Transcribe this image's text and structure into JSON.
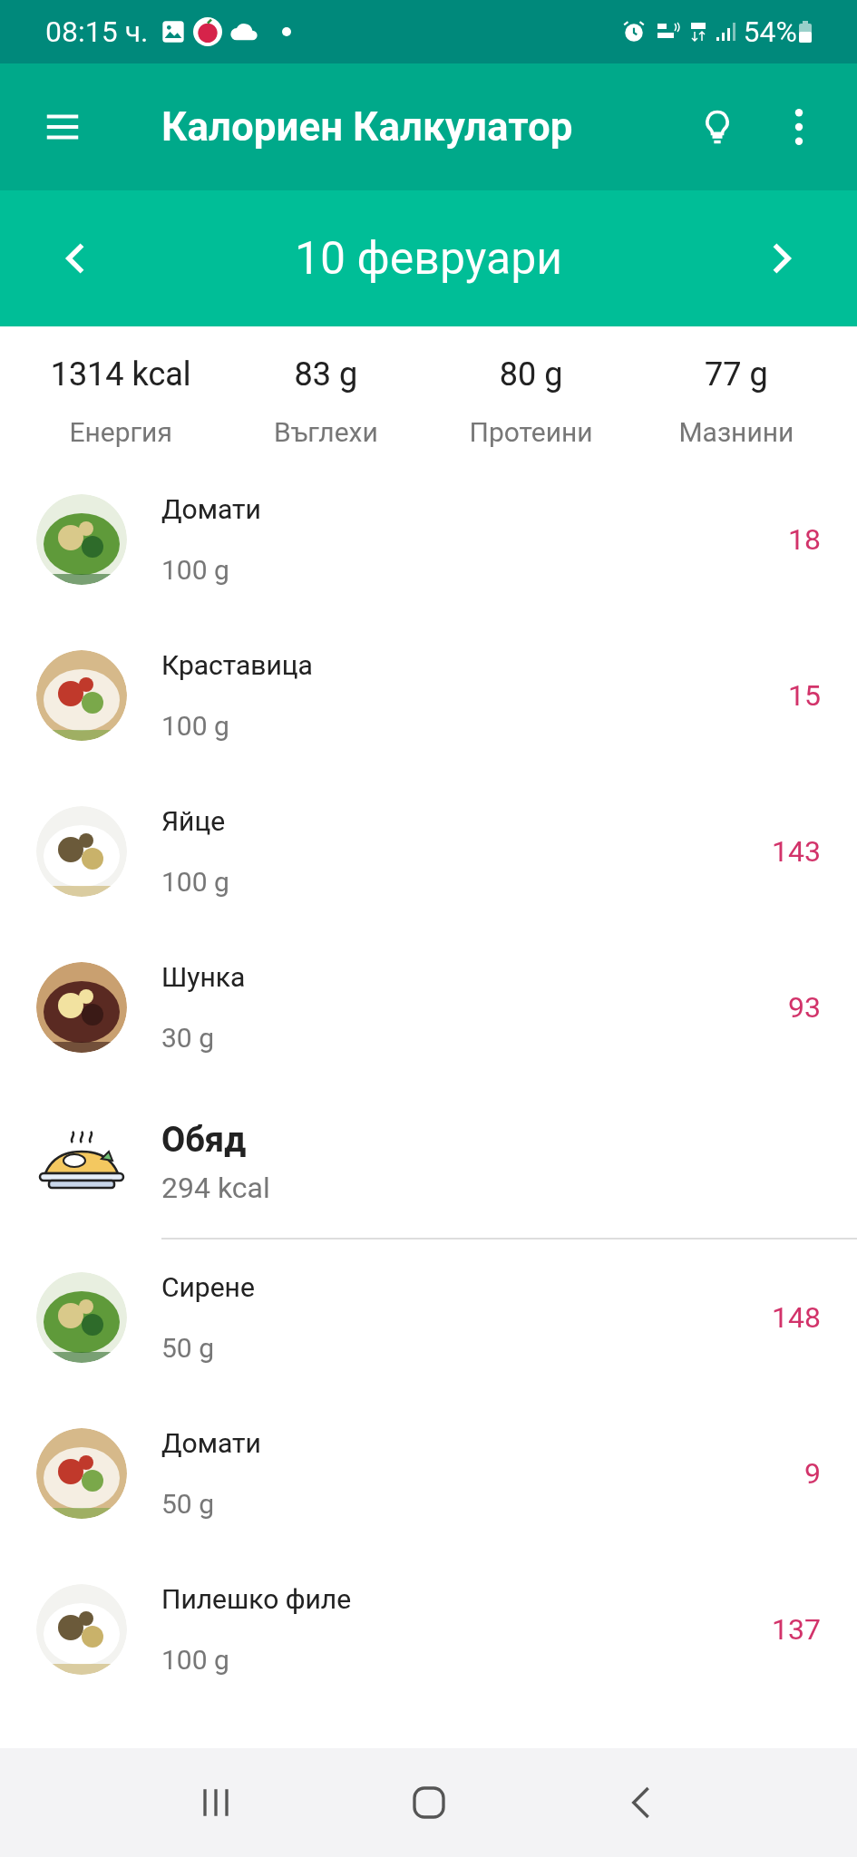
{
  "status_bar": {
    "time": "08:15 ч.",
    "battery": "54%"
  },
  "toolbar": {
    "title": "Калориен Калкулатор"
  },
  "date_bar": {
    "date": "10 февруари"
  },
  "summary": [
    {
      "value": "1314 kcal",
      "label": "Енергия"
    },
    {
      "value": "83 g",
      "label": "Въглехи"
    },
    {
      "value": "80 g",
      "label": "Протеини"
    },
    {
      "value": "77 g",
      "label": "Мазнини"
    }
  ],
  "items": [
    {
      "kind": "food",
      "name": "Домати",
      "amount": "100 g",
      "calories": "18"
    },
    {
      "kind": "food",
      "name": "Краставица",
      "amount": "100 g",
      "calories": "15"
    },
    {
      "kind": "food",
      "name": "Яйце",
      "amount": "100 g",
      "calories": "143"
    },
    {
      "kind": "food",
      "name": "Шунка",
      "amount": "30 g",
      "calories": "93"
    },
    {
      "kind": "meal",
      "name": "Обяд",
      "amount": "294 kcal"
    },
    {
      "kind": "food",
      "name": "Сирене",
      "amount": "50 g",
      "calories": "148"
    },
    {
      "kind": "food",
      "name": "Домати",
      "amount": "50 g",
      "calories": "9"
    },
    {
      "kind": "food",
      "name": "Пилешко филе",
      "amount": "100 g",
      "calories": "137"
    }
  ]
}
